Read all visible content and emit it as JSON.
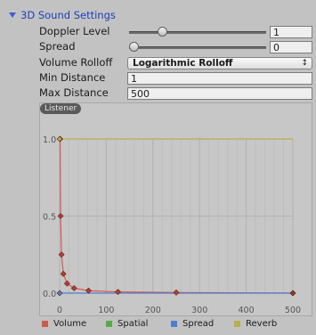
{
  "section": {
    "title": "3D Sound Settings"
  },
  "fields": {
    "doppler": {
      "label": "Doppler Level",
      "value": "1",
      "fraction": 0.22
    },
    "spread": {
      "label": "Spread",
      "value": "0",
      "fraction": 0.0
    },
    "rolloff": {
      "label": "Volume Rolloff",
      "value": "Logarithmic Rolloff",
      "arrow": "↕"
    },
    "min_distance": {
      "label": "Min Distance",
      "value": "1"
    },
    "max_distance": {
      "label": "Max Distance",
      "value": "500"
    }
  },
  "graph": {
    "tab_label": "Listener"
  },
  "colors": {
    "volume": "#d05a4e",
    "spatial": "#5aa84a",
    "spread": "#4f7ed0",
    "reverb": "#b5b04a"
  },
  "chart_data": {
    "type": "line",
    "xlim": [
      0,
      500
    ],
    "ylim": [
      0.0,
      1.0
    ],
    "x_ticks": [
      0,
      100,
      200,
      300,
      400,
      500
    ],
    "y_ticks": [
      "0.0",
      "0.5",
      "1.0"
    ],
    "grid": true,
    "legend_position": "bottom",
    "series": [
      {
        "name": "Volume",
        "color": "#d05a4e",
        "x": [
          0,
          1,
          2,
          4,
          8,
          16,
          31,
          62,
          125,
          250,
          500
        ],
        "y": [
          1.0,
          1.0,
          0.5,
          0.25,
          0.125,
          0.0625,
          0.032,
          0.016,
          0.008,
          0.004,
          0.0
        ]
      },
      {
        "name": "Spatial",
        "color": "#5aa84a",
        "x": [],
        "y": []
      },
      {
        "name": "Spread",
        "color": "#4f7ed0",
        "x": [
          0,
          500
        ],
        "y": [
          0.0,
          0.0
        ]
      },
      {
        "name": "Reverb",
        "color": "#b5b04a",
        "x": [
          0,
          500
        ],
        "y": [
          1.0,
          1.0
        ]
      }
    ]
  }
}
